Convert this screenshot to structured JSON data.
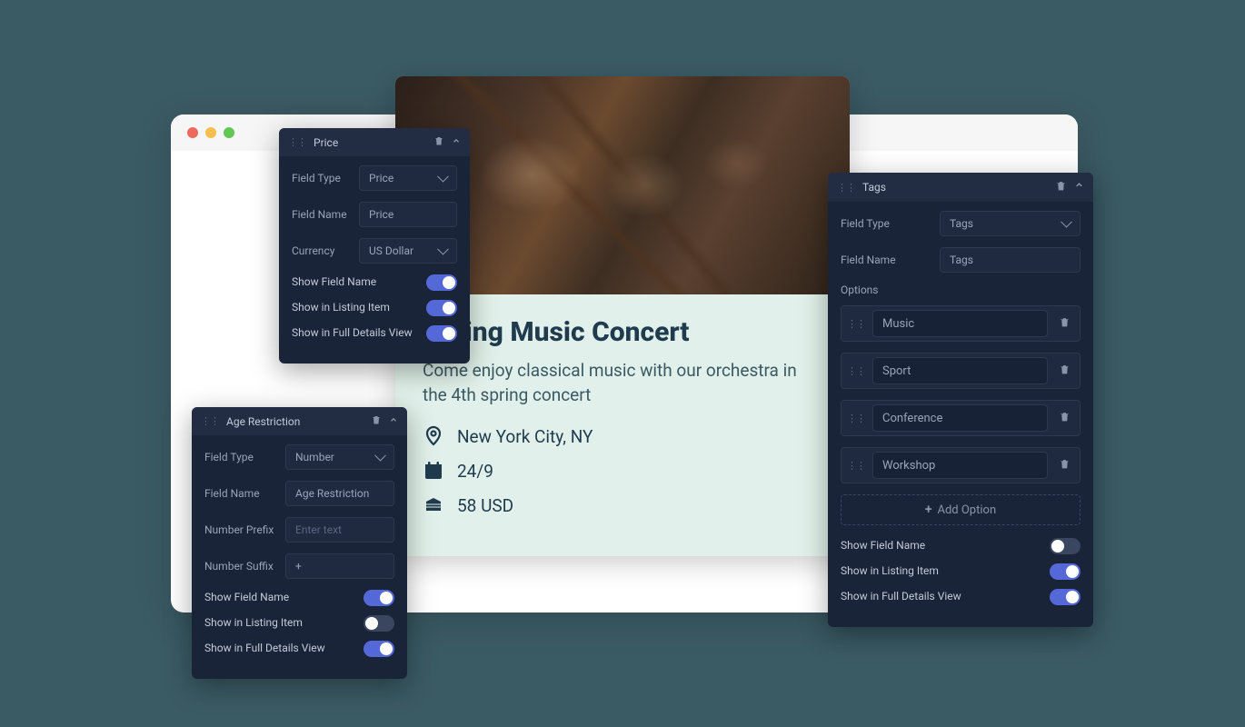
{
  "event": {
    "title": "Spring Music Concert",
    "description": "Come enjoy classical music with our orchestra in the 4th spring concert",
    "location": "New York City, NY",
    "date": "24/9",
    "price": "58 USD"
  },
  "panels": {
    "price": {
      "title": "Price",
      "fieldTypeLabel": "Field Type",
      "fieldTypeValue": "Price",
      "fieldNameLabel": "Field Name",
      "fieldNameValue": "Price",
      "currencyLabel": "Currency",
      "currencyValue": "US Dollar",
      "toggles": {
        "showFieldName": "Show Field Name",
        "showInListing": "Show in Listing Item",
        "showInDetails": "Show in Full Details View"
      }
    },
    "age": {
      "title": "Age Restriction",
      "fieldTypeLabel": "Field Type",
      "fieldTypeValue": "Number",
      "fieldNameLabel": "Field Name",
      "fieldNameValue": "Age Restriction",
      "prefixLabel": "Number Prefix",
      "prefixValue": "Enter text",
      "suffixLabel": "Number Suffix",
      "suffixValue": "+",
      "toggles": {
        "showFieldName": "Show Field Name",
        "showInListing": "Show in Listing Item",
        "showInDetails": "Show in Full Details View"
      }
    },
    "tags": {
      "title": "Tags",
      "fieldTypeLabel": "Field Type",
      "fieldTypeValue": "Tags",
      "fieldNameLabel": "Field Name",
      "fieldNameValue": "Tags",
      "optionsLabel": "Options",
      "options": [
        "Music",
        "Sport",
        "Conference",
        "Workshop"
      ],
      "addOption": "Add Option",
      "toggles": {
        "showFieldName": "Show Field Name",
        "showInListing": "Show in Listing Item",
        "showInDetails": "Show in Full Details View"
      }
    }
  }
}
